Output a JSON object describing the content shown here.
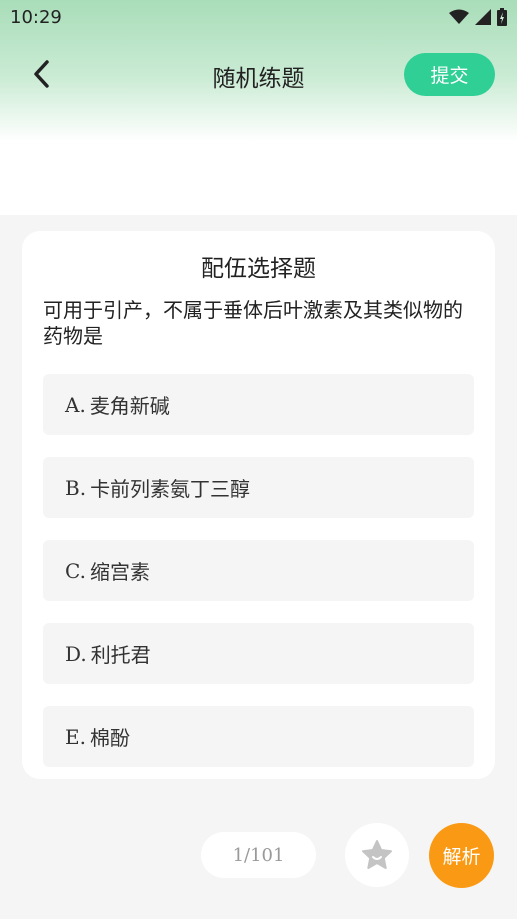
{
  "status_bar": {
    "time": "10:29",
    "icons": [
      "wifi-icon",
      "signal-icon",
      "battery-icon"
    ]
  },
  "header": {
    "back_icon": "chevron-left-icon",
    "title": "随机练题",
    "submit_label": "提交"
  },
  "question": {
    "type": "配伍选择题",
    "text": "可用于引产，不属于垂体后叶激素及其类似物的药物是",
    "options": [
      {
        "letter": "A.",
        "text": "麦角新碱"
      },
      {
        "letter": "B.",
        "text": "卡前列素氨丁三醇"
      },
      {
        "letter": "C.",
        "text": "缩宫素"
      },
      {
        "letter": "D.",
        "text": "利托君"
      },
      {
        "letter": "E.",
        "text": "棉酚"
      }
    ]
  },
  "footer": {
    "pager": "1/101",
    "favorite_icon": "star-icon",
    "analysis_label": "解析"
  },
  "colors": {
    "accent_green": "#2fcf96",
    "accent_orange": "#fa9a14",
    "header_gradient_top": "#a9ddb9"
  }
}
